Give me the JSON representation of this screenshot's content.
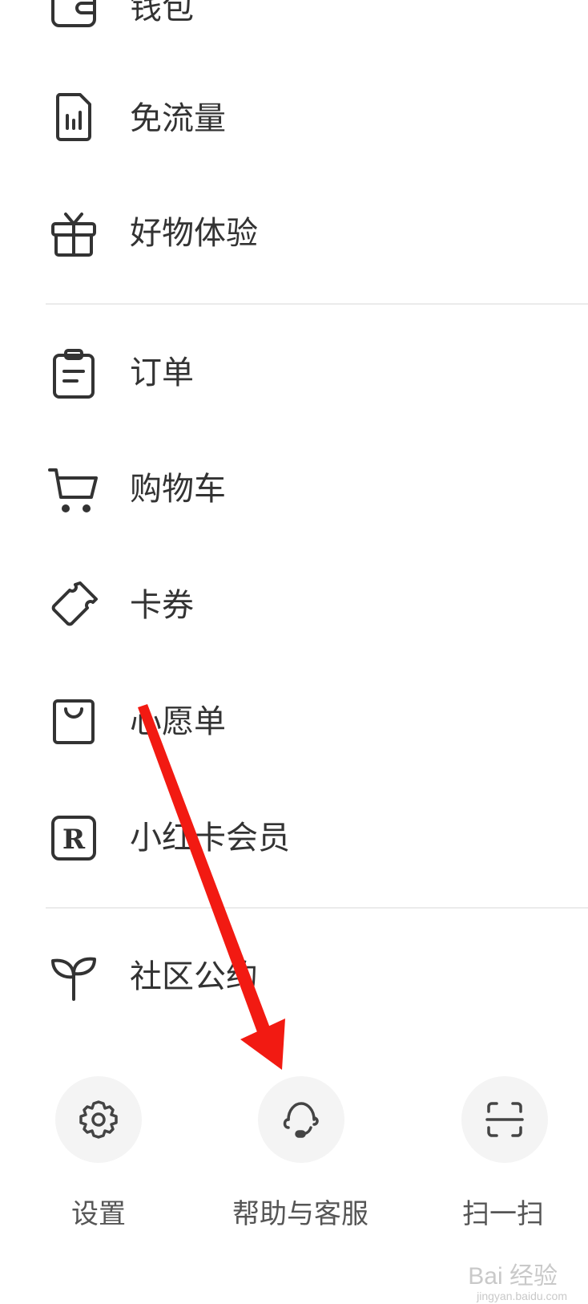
{
  "menu": {
    "group1": [
      {
        "label": "钱包",
        "icon": "wallet-icon"
      },
      {
        "label": "免流量",
        "icon": "data-sim-icon"
      },
      {
        "label": "好物体验",
        "icon": "gift-icon"
      }
    ],
    "group2": [
      {
        "label": "订单",
        "icon": "clipboard-icon"
      },
      {
        "label": "购物车",
        "icon": "cart-icon"
      },
      {
        "label": "卡券",
        "icon": "ticket-icon"
      },
      {
        "label": "心愿单",
        "icon": "bag-icon"
      },
      {
        "label": "小红卡会员",
        "icon": "r-badge-icon"
      }
    ],
    "group3": [
      {
        "label": "社区公约",
        "icon": "sprout-icon"
      }
    ]
  },
  "bottom_bar": {
    "settings": {
      "label": "设置",
      "icon": "gear-icon"
    },
    "help": {
      "label": "帮助与客服",
      "icon": "headset-icon"
    },
    "scan": {
      "label": "扫一扫",
      "icon": "scan-icon"
    }
  },
  "watermark": {
    "text": "Bai 经验",
    "url": "jingyan.baidu.com"
  },
  "colors": {
    "icon_stroke": "#333333",
    "divider": "#ebebeb",
    "circle_bg": "#f4f4f4",
    "arrow": "#f21a12"
  }
}
